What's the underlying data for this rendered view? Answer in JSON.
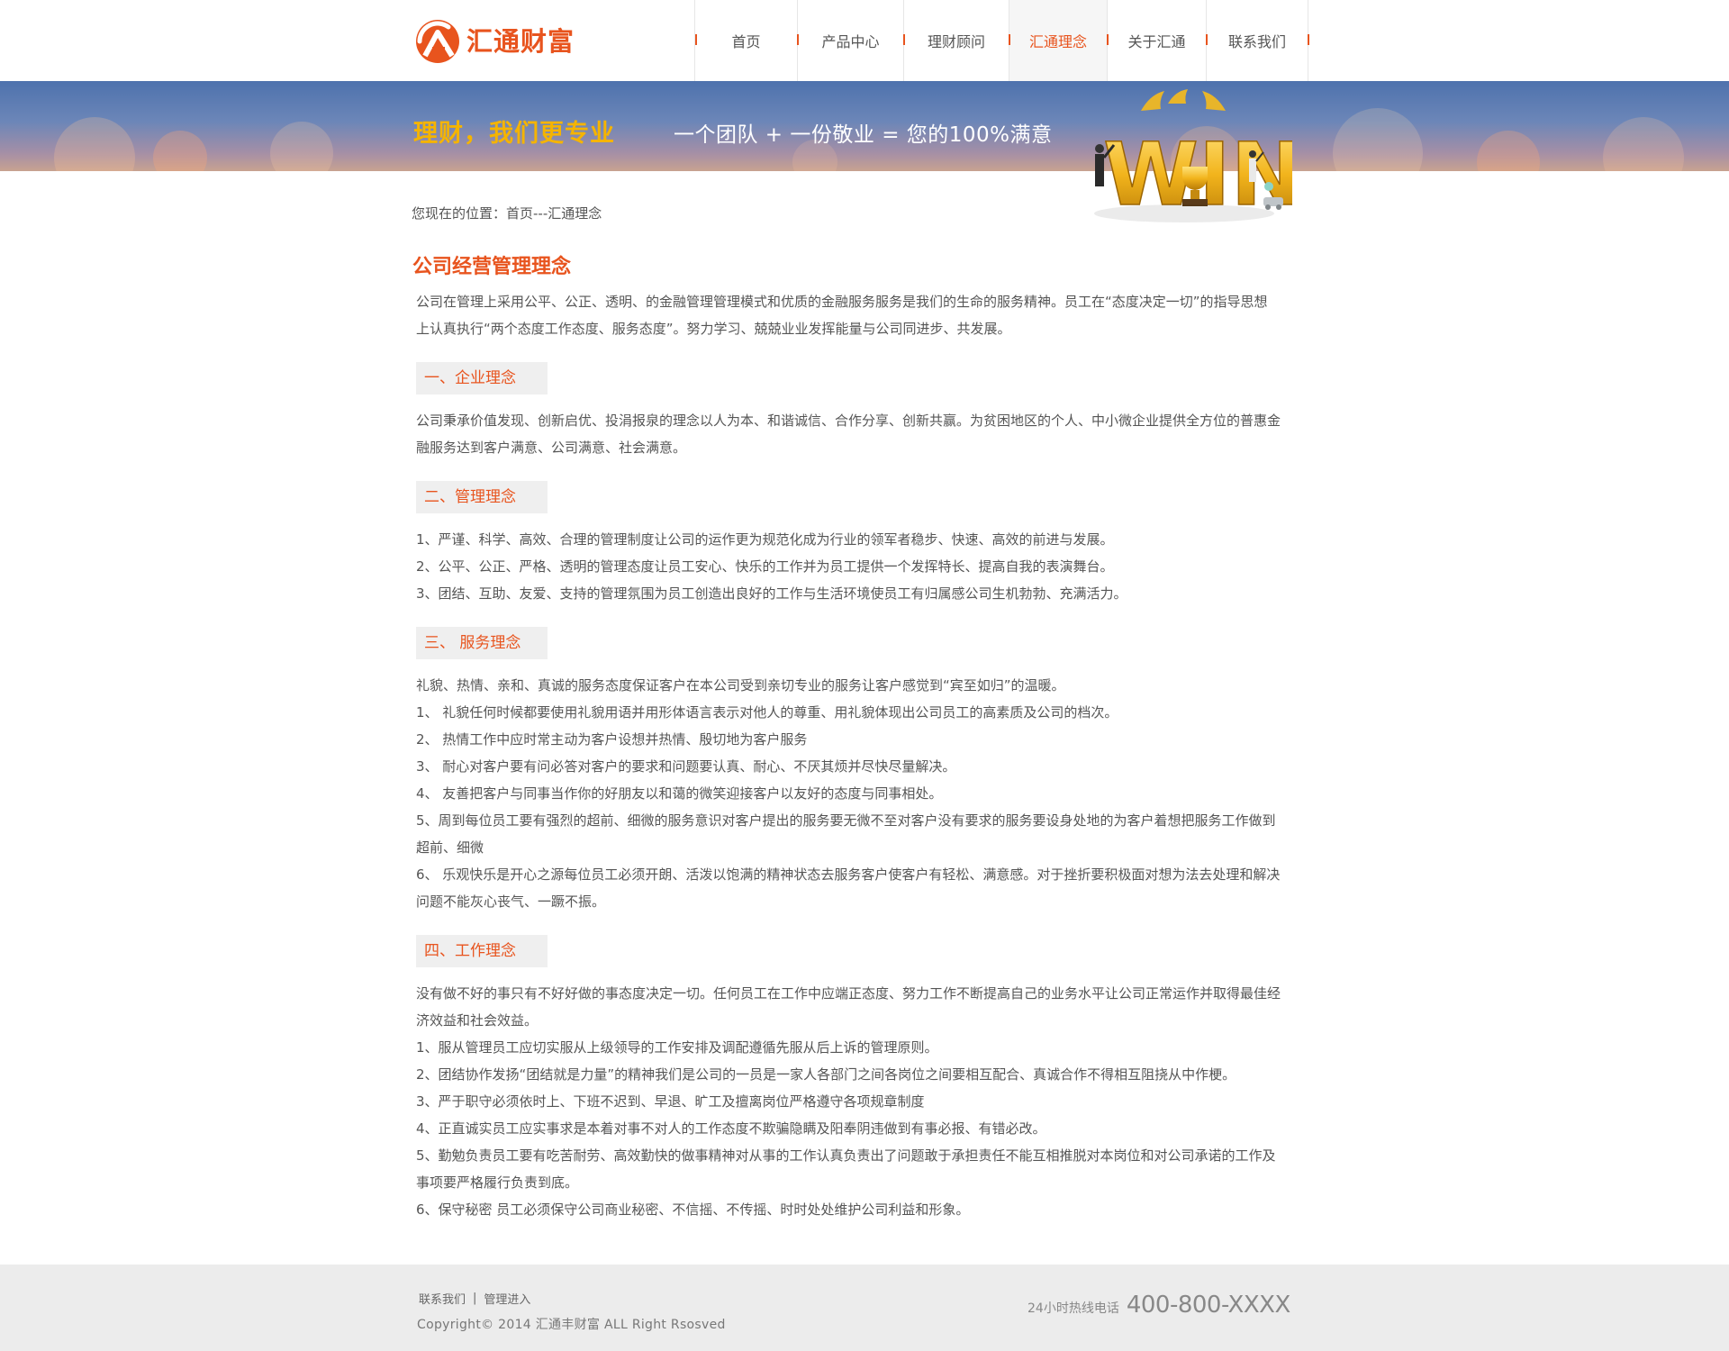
{
  "logo": {
    "text": "汇通财富",
    "icon": "logo-mark-icon",
    "brand_color": "#e8541e"
  },
  "nav": {
    "active_color": "#e8541e",
    "items": [
      {
        "label": "首页",
        "active": false
      },
      {
        "label": "产品中心",
        "active": false
      },
      {
        "label": "理财顾问",
        "active": false
      },
      {
        "label": "汇通理念",
        "active": true
      },
      {
        "label": "关于汇通",
        "active": false
      },
      {
        "label": "联系我们",
        "active": false
      }
    ]
  },
  "banner": {
    "slogan": "理财，我们更专业",
    "formula": "一个团队 + 一份敬业 = 您的100%满意",
    "art": "win-trophy-illustration",
    "art_text": "WIN"
  },
  "breadcrumb": "您现在的位置：首页---汇通理念",
  "page_title": "公司经营管理理念",
  "intro": "公司在管理上采用公平、公正、透明、的金融管理管理模式和优质的金融服务服务是我们的生命的服务精神。员工在“态度决定一切”的指导思想上认真执行“两个态度工作态度、服务态度”。努力学习、兢兢业业发挥能量与公司同进步、共发展。",
  "sections": [
    {
      "heading": "一、企业理念",
      "paragraphs": [
        "公司秉承价值发现、创新启优、投涓报泉的理念以人为本、和谐诚信、合作分享、创新共赢。为贫困地区的个人、中小微企业提供全方位的普惠金融服务达到客户满意、公司满意、社会满意。"
      ]
    },
    {
      "heading": "二、管理理念",
      "paragraphs": [
        "1、严谨、科学、高效、合理的管理制度让公司的运作更为规范化成为行业的领军者稳步、快速、高效的前进与发展。",
        "2、公平、公正、严格、透明的管理态度让员工安心、快乐的工作并为员工提供一个发挥特长、提高自我的表演舞台。",
        "3、团结、互助、友爱、支持的管理氛围为员工创造出良好的工作与生活环境使员工有归属感公司生机勃勃、充满活力。"
      ]
    },
    {
      "heading": "三、 服务理念",
      "paragraphs": [
        "礼貌、热情、亲和、真诚的服务态度保证客户在本公司受到亲切专业的服务让客户感觉到“宾至如归”的温暖。",
        "1、 礼貌任何时候都要使用礼貌用语并用形体语言表示对他人的尊重、用礼貌体现出公司员工的高素质及公司的档次。",
        "2、 热情工作中应时常主动为客户设想并热情、殷切地为客户服务",
        "3、 耐心对客户要有问必答对客户的要求和问题要认真、耐心、不厌其烦并尽快尽量解决。",
        "4、 友善把客户与同事当作你的好朋友以和蔼的微笑迎接客户以友好的态度与同事相处。",
        "5、周到每位员工要有强烈的超前、细微的服务意识对客户提出的服务要无微不至对客户没有要求的服务要设身处地的为客户着想把服务工作做到超前、细微",
        "6、 乐观快乐是开心之源每位员工必须开朗、活泼以饱满的精神状态去服务客户使客户有轻松、满意感。对于挫折要积极面对想为法去处理和解决问题不能灰心丧气、一蹶不振。"
      ]
    },
    {
      "heading": "四、工作理念",
      "paragraphs": [
        "没有做不好的事只有不好好做的事态度决定一切。任何员工在工作中应端正态度、努力工作不断提高自己的业务水平让公司正常运作并取得最佳经济效益和社会效益。",
        "1、服从管理员工应切实服从上级领导的工作安排及调配遵循先服从后上诉的管理原则。",
        "2、团结协作发扬“团结就是力量”的精神我们是公司的一员是一家人各部门之间各岗位之间要相互配合、真诚合作不得相互阻挠从中作梗。",
        "3、严于职守必须依时上、下班不迟到、早退、旷工及擅离岗位严格遵守各项规章制度",
        "4、正直诚实员工应实事求是本着对事不对人的工作态度不欺骗隐瞒及阳奉阴违做到有事必报、有错必改。",
        "5、勤勉负责员工要有吃苦耐劳、高效勤快的做事精神对从事的工作认真负责出了问题敢于承担责任不能互相推脱对本岗位和对公司承诺的工作及事项要严格履行负责到底。",
        "6、保守秘密 员工必须保守公司商业秘密、不信摇、不传摇、时时处处维护公司利益和形象。"
      ]
    }
  ],
  "footer": {
    "links": [
      "联系我们",
      "管理进入"
    ],
    "separator": "|",
    "copyright": "Copyright© 2014 汇通丰财富 ALL Right Rsosved",
    "hotline_label": "24小时热线电话",
    "hotline_number": "400-800-XXXX"
  }
}
